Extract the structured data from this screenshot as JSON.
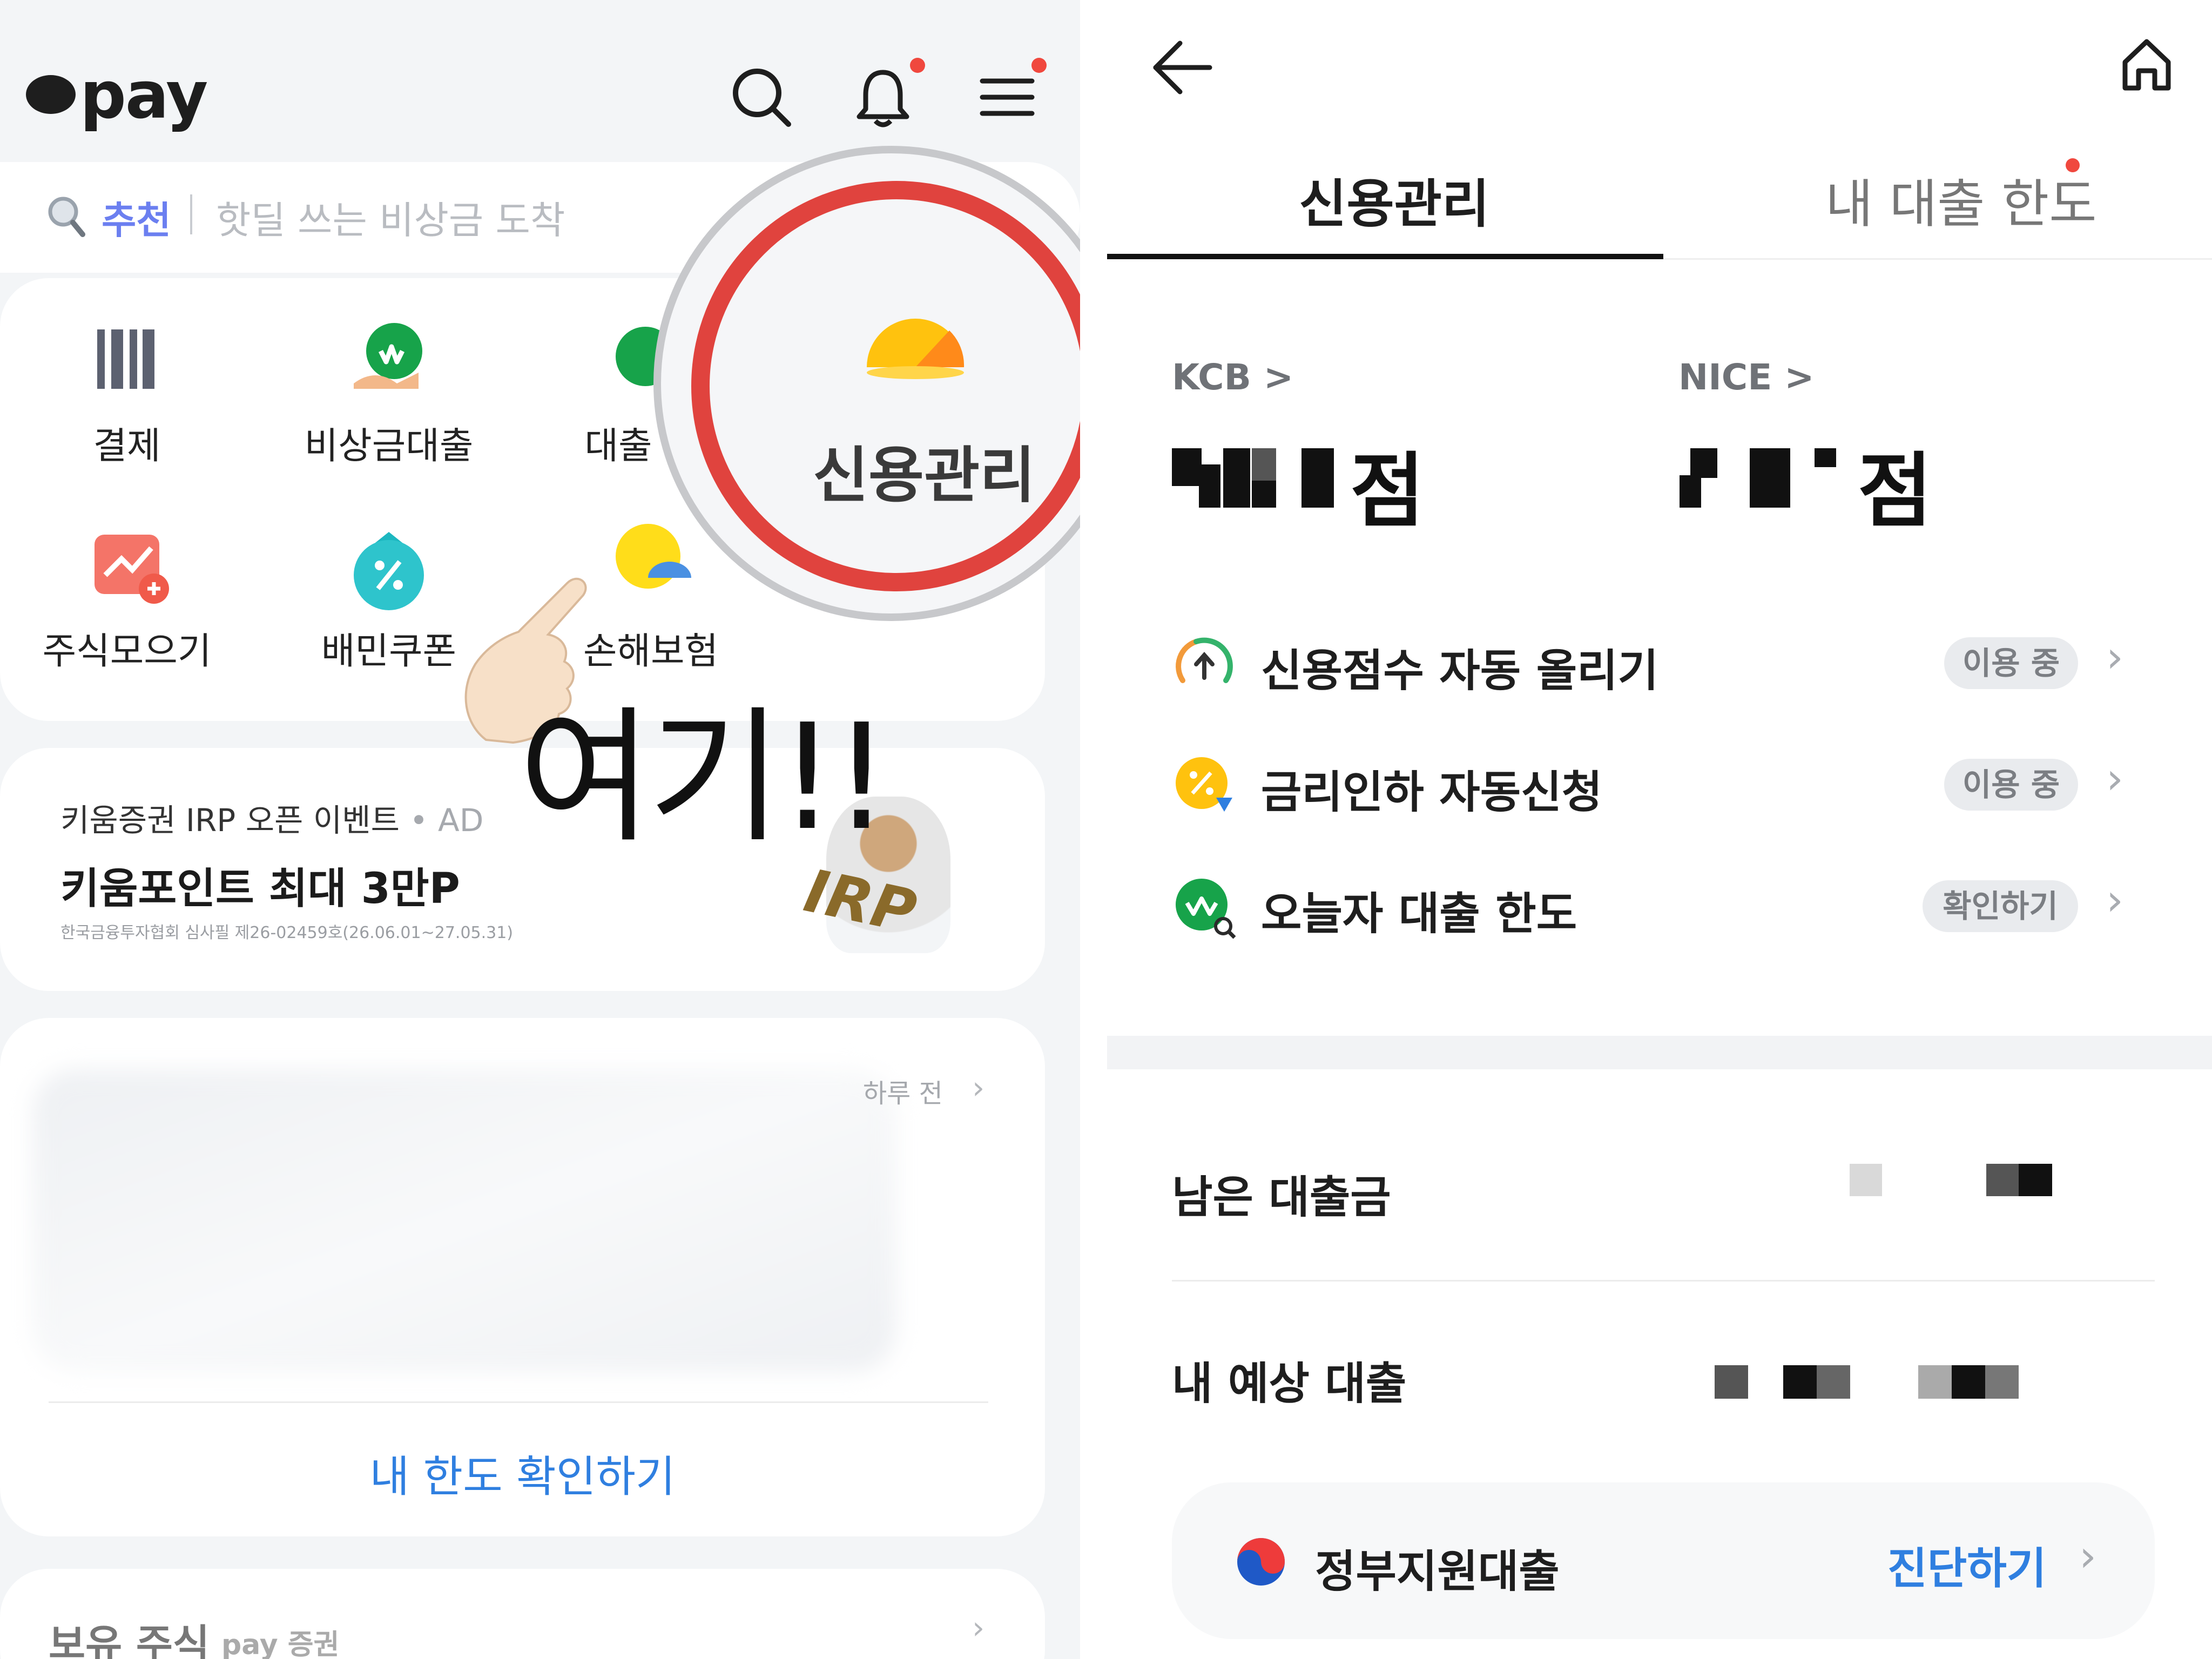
{
  "left": {
    "brand": "pay",
    "search": {
      "tag": "추천",
      "text": "핫딜 쓰는 비상금 도착"
    },
    "menu": [
      "결제",
      "비상금대출",
      "대출",
      "주식모으기",
      "배민쿠폰",
      "손해보험"
    ],
    "magnified_label": "신용관리",
    "overlay_text": "여기!!",
    "ad": {
      "title": "키움증권 IRP 오픈 이벤트",
      "tag": "• AD",
      "main": "키움포인트 최대 3만P",
      "fine": "한국금융투자협회 심사필 제26-02459호(26.06.01~27.05.31)",
      "badge": "IRP"
    },
    "timestamp": "하루 전",
    "limit_link": "내 한도 확인하기",
    "stock_section": "보유 주식",
    "stock_brand": "pay 증권"
  },
  "right": {
    "tabs": [
      "신용관리",
      "내 대출 한도"
    ],
    "bureaus": [
      {
        "name": "KCB >",
        "suffix": "점"
      },
      {
        "name": "NICE >",
        "suffix": "점"
      }
    ],
    "services": [
      {
        "label": "신용점수 자동 올리기",
        "status": "이용 중"
      },
      {
        "label": "금리인하 자동신청",
        "status": "이용 중"
      },
      {
        "label": "오늘자 대출 한도",
        "status": "확인하기"
      }
    ],
    "remaining_loan": "남은 대출금",
    "expected_loan": "내 예상 대출",
    "gov_loan": "정부지원대출",
    "gov_action": "진단하기"
  },
  "colors": {
    "accent_blue": "#2f7fe0",
    "alert_red": "#f0483e",
    "highlight_ring": "#e0433e",
    "kakao_yellow": "#ffcd00"
  }
}
